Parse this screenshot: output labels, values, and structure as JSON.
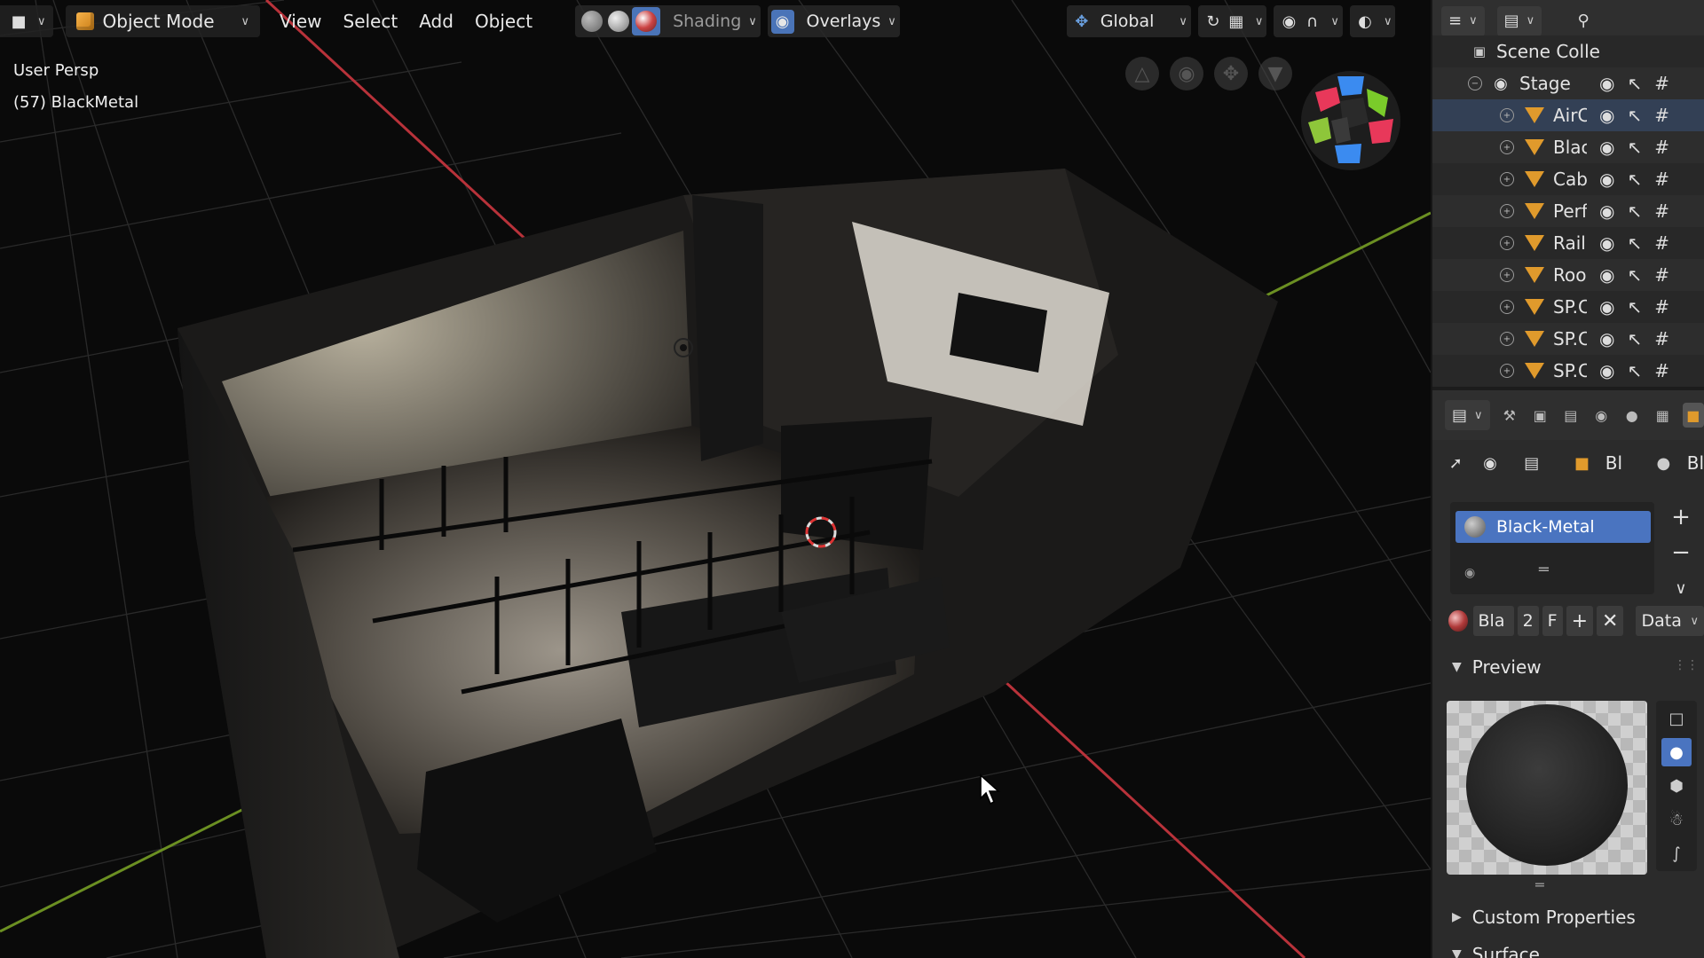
{
  "header": {
    "mode_label": "Object Mode",
    "menu": [
      "View",
      "Select",
      "Add",
      "Object"
    ],
    "shading_label": "Shading",
    "overlays_label": "Overlays",
    "orientation_label": "Global"
  },
  "viewport": {
    "view_name": "User Persp",
    "active_object": "(57) BlackMetal"
  },
  "outliner": {
    "rows": [
      {
        "name": "Scene Colle",
        "type": "collection"
      },
      {
        "name": "Stage",
        "type": "collection"
      },
      {
        "name": "AirC",
        "type": "mesh"
      },
      {
        "name": "Blac",
        "type": "mesh"
      },
      {
        "name": "Cab",
        "type": "mesh"
      },
      {
        "name": "Perf",
        "type": "mesh"
      },
      {
        "name": "Rail",
        "type": "mesh"
      },
      {
        "name": "Roo",
        "type": "mesh"
      },
      {
        "name": "SP.C",
        "type": "mesh"
      },
      {
        "name": "SP.C",
        "type": "mesh"
      },
      {
        "name": "SP.C",
        "type": "mesh"
      }
    ]
  },
  "properties": {
    "object_short": "Bl",
    "material_short": "Bl",
    "slot_name": "Black-Metal",
    "mat_name_short": "Bla",
    "user_count": "2",
    "fake_user": "F",
    "link_mode": "Data",
    "sections": {
      "preview": "Preview",
      "custom_properties": "Custom Properties",
      "surface": "Surface"
    }
  },
  "colors": {
    "accent_blue": "#4a74c0",
    "x_axis": "#b8323a",
    "y_axis": "#6b8f22",
    "mesh_icon": "#e09a2c"
  }
}
